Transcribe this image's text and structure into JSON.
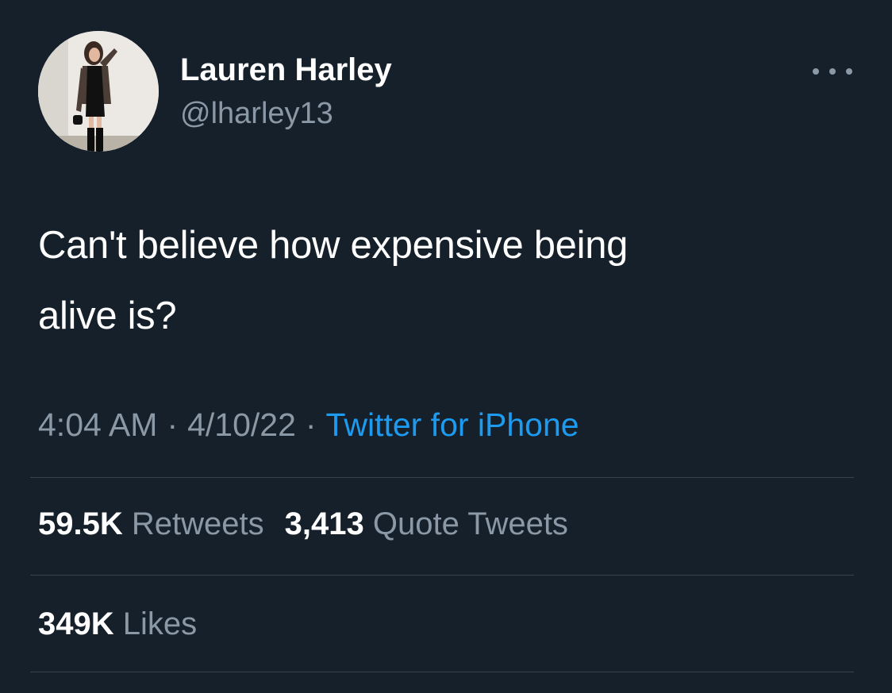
{
  "author": {
    "name": "Lauren Harley",
    "handle": "@lharley13",
    "avatar": "profile-photo"
  },
  "tweet": {
    "text_line1": "Can't believe how expensive being",
    "text_line2": "alive is?"
  },
  "meta": {
    "time": "4:04 AM",
    "date": "4/10/22",
    "separator": "·",
    "source": "Twitter for iPhone"
  },
  "stats": {
    "retweets_count": "59.5K",
    "retweets_label": "Retweets",
    "quotes_count": "3,413",
    "quotes_label": "Quote Tweets",
    "likes_count": "349K",
    "likes_label": "Likes"
  },
  "icons": {
    "more": "more-horizontal-icon"
  },
  "colors": {
    "background": "#15202b",
    "primary_text": "#ffffff",
    "secondary_text": "#8b98a5",
    "link": "#1d9bf0",
    "divider": "#38444d"
  }
}
